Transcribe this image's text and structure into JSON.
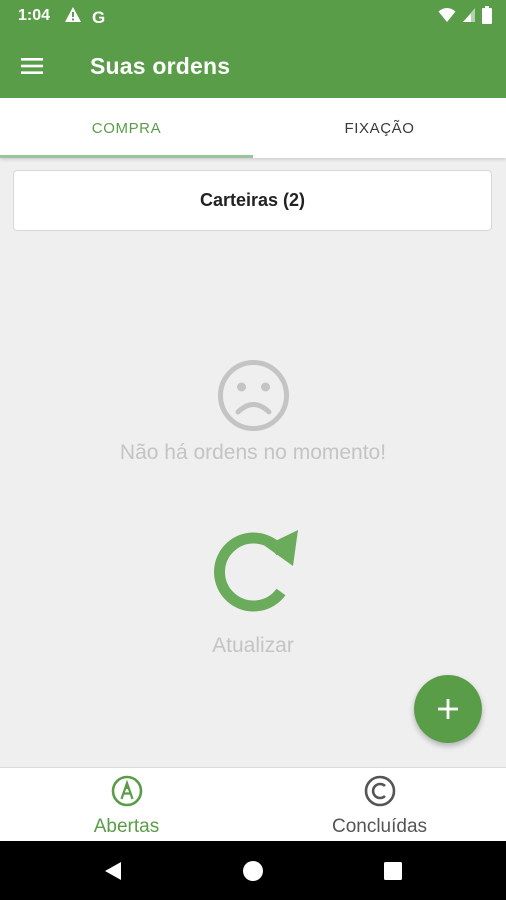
{
  "status_bar": {
    "time": "1:04",
    "carrier_letter": "G",
    "icons": [
      "warning-icon",
      "google-icon",
      "wifi-icon",
      "signal-icon",
      "battery-icon"
    ]
  },
  "app_bar": {
    "title": "Suas ordens",
    "menu_icon": "hamburger-menu-icon",
    "color": "#5a9d49"
  },
  "tabs": [
    {
      "label": "COMPRA",
      "active": true
    },
    {
      "label": "FIXAÇÃO",
      "active": false
    }
  ],
  "wallet": {
    "label": "Carteiras (2)"
  },
  "empty_state": {
    "icon": "sad-face-icon",
    "message": "Não há ordens no momento!"
  },
  "refresh": {
    "icon": "refresh-icon",
    "label": "Atualizar"
  },
  "fab": {
    "icon": "plus-icon"
  },
  "bottom_nav": [
    {
      "label": "Abertas",
      "icon": "a-circle-icon",
      "active": true
    },
    {
      "label": "Concluídas",
      "icon": "c-circle-icon",
      "active": false
    }
  ],
  "system_nav": {
    "icons": [
      "back-icon",
      "home-icon",
      "recents-icon"
    ]
  },
  "colors": {
    "primary": "#5a9d49",
    "tab_indicator": "#9cc49a",
    "muted_text": "#c4c4c4",
    "background": "#efefef"
  }
}
